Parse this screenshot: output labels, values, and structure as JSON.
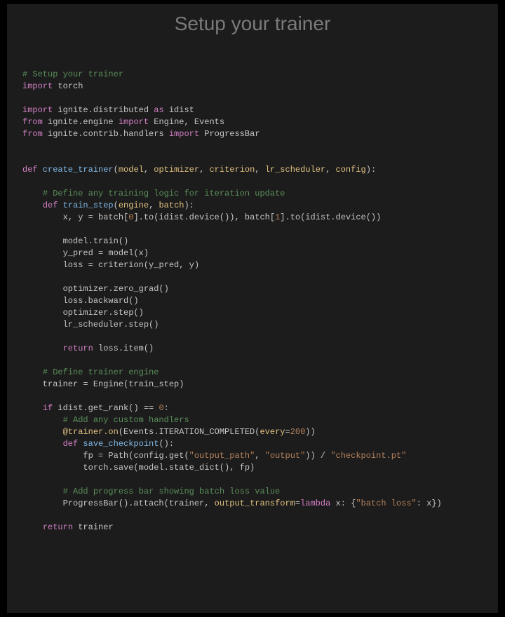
{
  "title": "Setup your trainer",
  "code_tokens": [
    [
      [
        "c-comment",
        "# Setup your trainer"
      ]
    ],
    [
      [
        "c-keyword",
        "import"
      ],
      [
        "c-module",
        " torch"
      ]
    ],
    [],
    [
      [
        "c-keyword",
        "import"
      ],
      [
        "c-module",
        " ignite.distributed "
      ],
      [
        "c-keyword",
        "as"
      ],
      [
        "c-module",
        " idist"
      ]
    ],
    [
      [
        "c-keyword",
        "from"
      ],
      [
        "c-module",
        " ignite.engine "
      ],
      [
        "c-keyword",
        "import"
      ],
      [
        "c-module",
        " Engine, Events"
      ]
    ],
    [
      [
        "c-keyword",
        "from"
      ],
      [
        "c-module",
        " ignite.contrib.handlers "
      ],
      [
        "c-keyword",
        "import"
      ],
      [
        "c-module",
        " ProgressBar"
      ]
    ],
    [],
    [],
    [
      [
        "c-def",
        "def "
      ],
      [
        "c-func",
        "create_trainer"
      ],
      [
        "c-paren",
        "("
      ],
      [
        "c-param",
        "model"
      ],
      [
        "c-paren",
        ", "
      ],
      [
        "c-param",
        "optimizer"
      ],
      [
        "c-paren",
        ", "
      ],
      [
        "c-param",
        "criterion"
      ],
      [
        "c-paren",
        ", "
      ],
      [
        "c-param",
        "lr_scheduler"
      ],
      [
        "c-paren",
        ", "
      ],
      [
        "c-param",
        "config"
      ],
      [
        "c-paren",
        "):"
      ]
    ],
    [],
    [
      [
        "c-builtin",
        "    "
      ],
      [
        "c-comment",
        "# Define any training logic for iteration update"
      ]
    ],
    [
      [
        "c-builtin",
        "    "
      ],
      [
        "c-def",
        "def "
      ],
      [
        "c-func",
        "train_step"
      ],
      [
        "c-paren",
        "("
      ],
      [
        "c-param",
        "engine"
      ],
      [
        "c-paren",
        ", "
      ],
      [
        "c-param",
        "batch"
      ],
      [
        "c-paren",
        "):"
      ]
    ],
    [
      [
        "c-builtin",
        "        x, y "
      ],
      [
        "c-op",
        "="
      ],
      [
        "c-builtin",
        " batch["
      ],
      [
        "c-num",
        "0"
      ],
      [
        "c-builtin",
        "].to(idist.device()), batch["
      ],
      [
        "c-num",
        "1"
      ],
      [
        "c-builtin",
        "].to(idist.device())"
      ]
    ],
    [],
    [
      [
        "c-builtin",
        "        model.train()"
      ]
    ],
    [
      [
        "c-builtin",
        "        y_pred "
      ],
      [
        "c-op",
        "="
      ],
      [
        "c-builtin",
        " model(x)"
      ]
    ],
    [
      [
        "c-builtin",
        "        loss "
      ],
      [
        "c-op",
        "="
      ],
      [
        "c-builtin",
        " criterion(y_pred, y)"
      ]
    ],
    [],
    [
      [
        "c-builtin",
        "        optimizer.zero_grad()"
      ]
    ],
    [
      [
        "c-builtin",
        "        loss.backward()"
      ]
    ],
    [
      [
        "c-builtin",
        "        optimizer.step()"
      ]
    ],
    [
      [
        "c-builtin",
        "        lr_scheduler.step()"
      ]
    ],
    [],
    [
      [
        "c-builtin",
        "        "
      ],
      [
        "c-keyword",
        "return"
      ],
      [
        "c-builtin",
        " loss.item()"
      ]
    ],
    [],
    [
      [
        "c-builtin",
        "    "
      ],
      [
        "c-comment",
        "# Define trainer engine"
      ]
    ],
    [
      [
        "c-builtin",
        "    trainer "
      ],
      [
        "c-op",
        "="
      ],
      [
        "c-builtin",
        " Engine(train_step)"
      ]
    ],
    [],
    [
      [
        "c-builtin",
        "    "
      ],
      [
        "c-keyword",
        "if"
      ],
      [
        "c-builtin",
        " idist.get_rank() "
      ],
      [
        "c-op",
        "=="
      ],
      [
        "c-builtin",
        " "
      ],
      [
        "c-num",
        "0"
      ],
      [
        "c-builtin",
        ":"
      ]
    ],
    [
      [
        "c-builtin",
        "        "
      ],
      [
        "c-comment",
        "# Add any custom handlers"
      ]
    ],
    [
      [
        "c-builtin",
        "        "
      ],
      [
        "c-at",
        "@trainer.on"
      ],
      [
        "c-builtin",
        "(Events.ITERATION_COMPLETED("
      ],
      [
        "c-param",
        "every"
      ],
      [
        "c-op",
        "="
      ],
      [
        "c-num",
        "200"
      ],
      [
        "c-builtin",
        "))"
      ]
    ],
    [
      [
        "c-builtin",
        "        "
      ],
      [
        "c-def",
        "def "
      ],
      [
        "c-func",
        "save_checkpoint"
      ],
      [
        "c-paren",
        "():"
      ]
    ],
    [
      [
        "c-builtin",
        "            fp "
      ],
      [
        "c-op",
        "="
      ],
      [
        "c-builtin",
        " Path(config.get("
      ],
      [
        "c-str",
        "\"output_path\""
      ],
      [
        "c-builtin",
        ", "
      ],
      [
        "c-str",
        "\"output\""
      ],
      [
        "c-builtin",
        ")) "
      ],
      [
        "c-op",
        "/"
      ],
      [
        "c-builtin",
        " "
      ],
      [
        "c-str",
        "\"checkpoint.pt\""
      ]
    ],
    [
      [
        "c-builtin",
        "            torch.save(model.state_dict(), fp)"
      ]
    ],
    [],
    [
      [
        "c-builtin",
        "        "
      ],
      [
        "c-comment",
        "# Add progress bar showing batch loss value"
      ]
    ],
    [
      [
        "c-builtin",
        "        ProgressBar().attach(trainer, "
      ],
      [
        "c-param",
        "output_transform"
      ],
      [
        "c-op",
        "="
      ],
      [
        "c-keyword",
        "lambda"
      ],
      [
        "c-builtin",
        " x: {"
      ],
      [
        "c-str",
        "\"batch loss\""
      ],
      [
        "c-builtin",
        ": x})"
      ]
    ],
    [],
    [
      [
        "c-builtin",
        "    "
      ],
      [
        "c-keyword",
        "return"
      ],
      [
        "c-builtin",
        " trainer"
      ]
    ]
  ]
}
